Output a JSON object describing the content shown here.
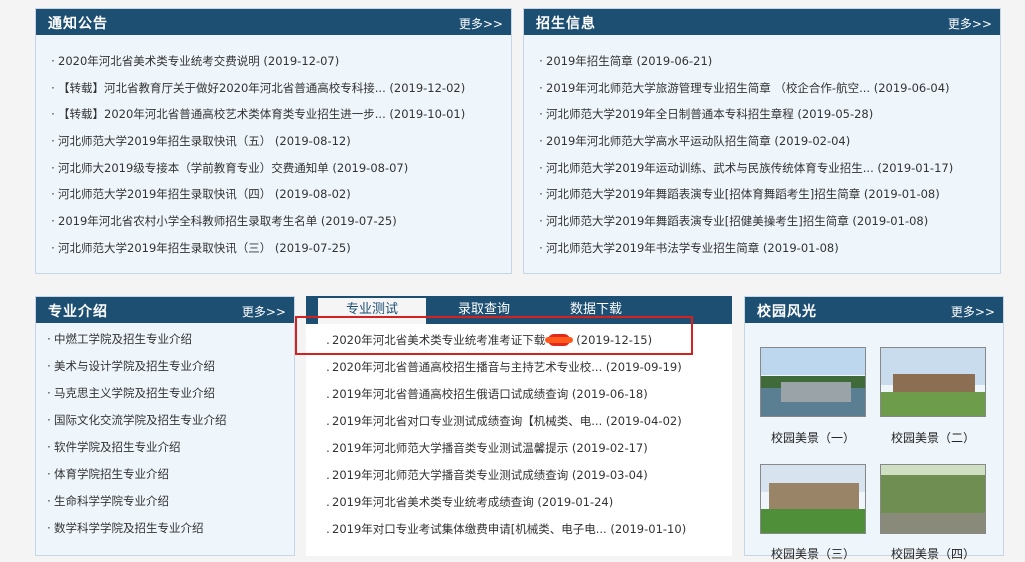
{
  "notice": {
    "title": "通知公告",
    "more": "更多>>",
    "items": [
      {
        "text": "2020年河北省美术类专业统考交费说明",
        "date": "(2019-12-07)"
      },
      {
        "text": "【转载】河北省教育厅关于做好2020年河北省普通高校专科接...",
        "date": "(2019-12-02)"
      },
      {
        "text": "【转载】2020年河北省普通高校艺术类体育类专业招生进一步...",
        "date": "(2019-10-01)"
      },
      {
        "text": "河北师范大学2019年招生录取快讯（五）",
        "date": "(2019-08-12)"
      },
      {
        "text": "河北师大2019级专接本（学前教育专业）交费通知单",
        "date": "(2019-08-07)"
      },
      {
        "text": "河北师范大学2019年招生录取快讯（四）",
        "date": "(2019-08-02)"
      },
      {
        "text": "2019年河北省农村小学全科教师招生录取考生名单",
        "date": "(2019-07-25)"
      },
      {
        "text": "河北师范大学2019年招生录取快讯（三）",
        "date": "(2019-07-25)"
      }
    ]
  },
  "admission": {
    "title": "招生信息",
    "more": "更多>>",
    "items": [
      {
        "text": "2019年招生简章",
        "date": "(2019-06-21)"
      },
      {
        "text": "2019年河北师范大学旅游管理专业招生简章 （校企合作-航空...",
        "date": "(2019-06-04)"
      },
      {
        "text": "河北师范大学2019年全日制普通本专科招生章程",
        "date": "(2019-05-28)"
      },
      {
        "text": "2019年河北师范大学高水平运动队招生简章",
        "date": "(2019-02-04)"
      },
      {
        "text": "河北师范大学2019年运动训练、武术与民族传统体育专业招生...",
        "date": "(2019-01-17)"
      },
      {
        "text": "河北师范大学2019年舞蹈表演专业[招体育舞蹈考生]招生简章",
        "date": "(2019-01-08)"
      },
      {
        "text": "河北师范大学2019年舞蹈表演专业[招健美操考生]招生简章",
        "date": "(2019-01-08)"
      },
      {
        "text": "河北师范大学2019年书法学专业招生简章",
        "date": "(2019-01-08)"
      }
    ]
  },
  "majors": {
    "title": "专业介绍",
    "more": "更多>>",
    "items": [
      "中燃工学院及招生专业介绍",
      "美术与设计学院及招生专业介绍",
      "马克思主义学院及招生专业介绍",
      "国际文化交流学院及招生专业介绍",
      "软件学院及招生专业介绍",
      "体育学院招生专业介绍",
      "生命科学学院专业介绍",
      "数学科学学院及招生专业介绍"
    ]
  },
  "tabs": {
    "labels": [
      "专业测试",
      "录取查询",
      "数据下载"
    ],
    "active": 0,
    "items": [
      {
        "text": "2020年河北省美术类专业统考准考证下载",
        "date": "(2019-12-15)",
        "hot": true
      },
      {
        "text": "2020年河北省普通高校招生播音与主持艺术专业校...",
        "date": "(2019-09-19)"
      },
      {
        "text": "2019年河北省普通高校招生俄语口试成绩查询",
        "date": "(2019-06-18)"
      },
      {
        "text": "2019年河北省对口专业测试成绩查询【机械类、电...",
        "date": "(2019-04-02)"
      },
      {
        "text": "2019年河北师范大学播音类专业测试温馨提示",
        "date": "(2019-02-17)"
      },
      {
        "text": "2019年河北师范大学播音类专业测试成绩查询",
        "date": "(2019-03-04)"
      },
      {
        "text": "2019年河北省美术类专业统考成绩查询",
        "date": "(2019-01-24)"
      },
      {
        "text": "2019年对口专业考试集体缴费申请[机械类、电子电...",
        "date": "(2019-01-10)"
      }
    ]
  },
  "campus": {
    "title": "校园风光",
    "more": "更多>>",
    "photos": [
      "校园美景（一）",
      "校园美景（二）",
      "校园美景（三）",
      "校园美景（四）"
    ]
  }
}
